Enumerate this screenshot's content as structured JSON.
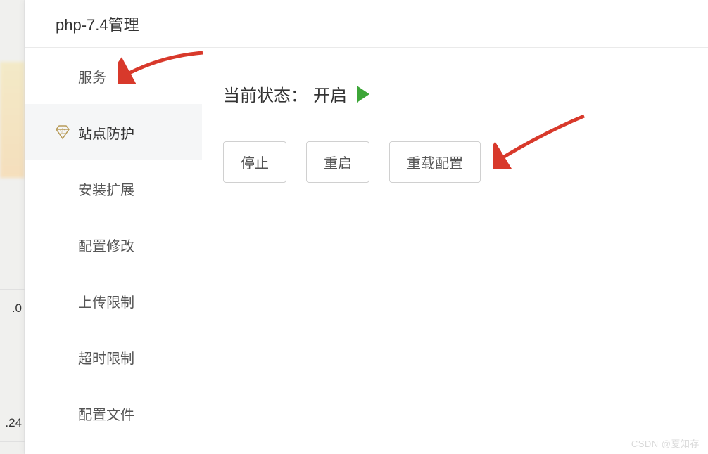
{
  "header": {
    "title": "php-7.4管理"
  },
  "nav": {
    "items": [
      {
        "label": "服务"
      },
      {
        "label": "站点防护"
      },
      {
        "label": "安装扩展"
      },
      {
        "label": "配置修改"
      },
      {
        "label": "上传限制"
      },
      {
        "label": "超时限制"
      },
      {
        "label": "配置文件"
      }
    ]
  },
  "content": {
    "status_label": "当前状态：",
    "status_value": "开启",
    "buttons": {
      "stop": "停止",
      "restart": "重启",
      "reload": "重载配置"
    }
  },
  "bg": {
    "row1": ".0",
    "row2": ".24"
  },
  "watermark": "CSDN @夏知存"
}
